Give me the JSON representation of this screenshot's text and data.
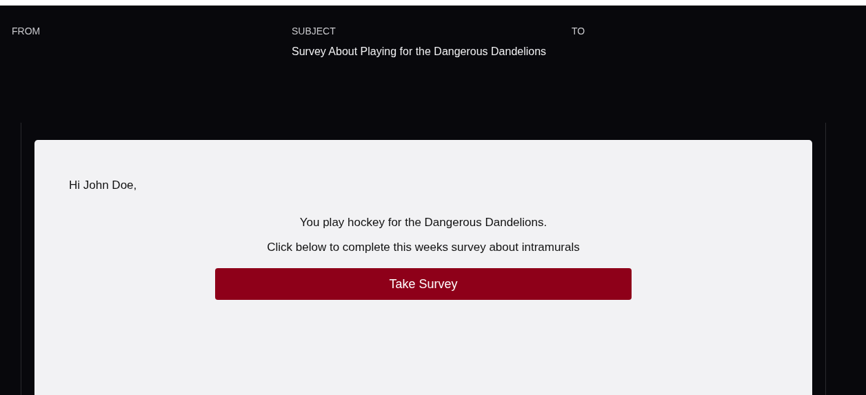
{
  "header": {
    "fields": [
      {
        "label": "FROM"
      },
      {
        "label": "SUBJECT",
        "value": "Survey About Playing for the Dangerous Dandelions"
      },
      {
        "label": "TO"
      }
    ]
  },
  "email": {
    "greeting": "Hi John Doe,",
    "lines": [
      "You play hockey for the Dangerous Dandelions.",
      "Click below to complete this weeks survey about intramurals"
    ],
    "button": "Take Survey"
  }
}
